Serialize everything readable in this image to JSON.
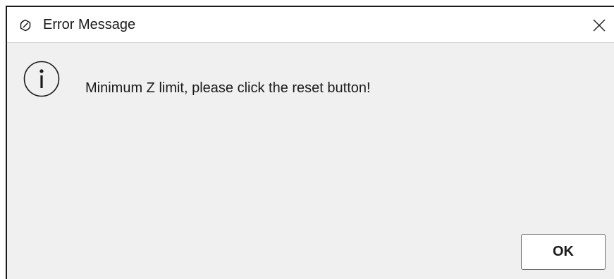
{
  "window": {
    "title": "Error Message",
    "app_icon": "app-logo-icon",
    "close_icon": "close-icon"
  },
  "dialog": {
    "icon": "info-icon",
    "message": "Minimum Z limit, please click the reset button!",
    "ok_label": "OK"
  },
  "colors": {
    "titlebar_bg": "#ffffff",
    "body_bg": "#f0f0f0",
    "text": "#1a1a1a",
    "border": "#1a1a1a"
  }
}
